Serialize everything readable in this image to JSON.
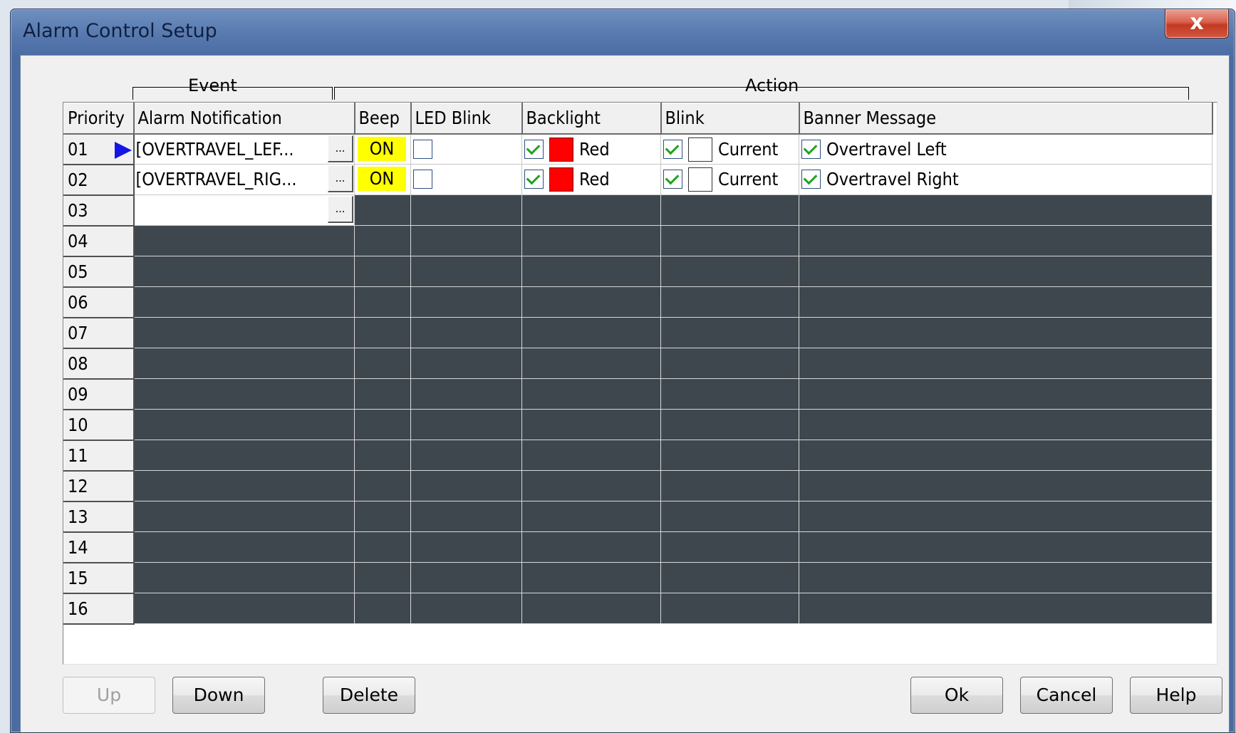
{
  "window": {
    "title": "Alarm Control Setup",
    "close_label": "x"
  },
  "groups": {
    "event": "Event",
    "action": "Action"
  },
  "columns": {
    "priority": "Priority",
    "alarm_notification": "Alarm Notification",
    "beep": "Beep",
    "led_blink": "LED Blink",
    "backlight": "Backlight",
    "blink": "Blink",
    "banner_message": "Banner Message"
  },
  "rows": [
    {
      "priority": "01",
      "alarm": "[OVERTRAVEL_LEF...",
      "ellipsis": "...",
      "beep": "ON",
      "led_blink": false,
      "backlight_checked": true,
      "backlight_color": "#ff0000",
      "backlight_label": "Red",
      "blink_checked": true,
      "blink_color": "#ffffff",
      "blink_label": "Current",
      "banner_checked": true,
      "banner_text": "Overtravel Left",
      "selected": true
    },
    {
      "priority": "02",
      "alarm": "[OVERTRAVEL_RIG...",
      "ellipsis": "...",
      "beep": "ON",
      "led_blink": false,
      "backlight_checked": true,
      "backlight_color": "#ff0000",
      "backlight_label": "Red",
      "blink_checked": true,
      "blink_color": "#ffffff",
      "blink_label": "Current",
      "banner_checked": true,
      "banner_text": "Overtravel Right",
      "selected": false
    },
    {
      "priority": "03",
      "alarm": "",
      "ellipsis": "..."
    },
    {
      "priority": "04"
    },
    {
      "priority": "05"
    },
    {
      "priority": "06"
    },
    {
      "priority": "07"
    },
    {
      "priority": "08"
    },
    {
      "priority": "09"
    },
    {
      "priority": "10"
    },
    {
      "priority": "11"
    },
    {
      "priority": "12"
    },
    {
      "priority": "13"
    },
    {
      "priority": "14"
    },
    {
      "priority": "15"
    },
    {
      "priority": "16"
    }
  ],
  "buttons": {
    "up": "Up",
    "down": "Down",
    "delete": "Delete",
    "ok": "Ok",
    "cancel": "Cancel",
    "help": "Help"
  },
  "colors": {
    "beep_on": "#ffff00",
    "empty_cell": "#3e474e",
    "selection_arrow": "#1414e6"
  }
}
